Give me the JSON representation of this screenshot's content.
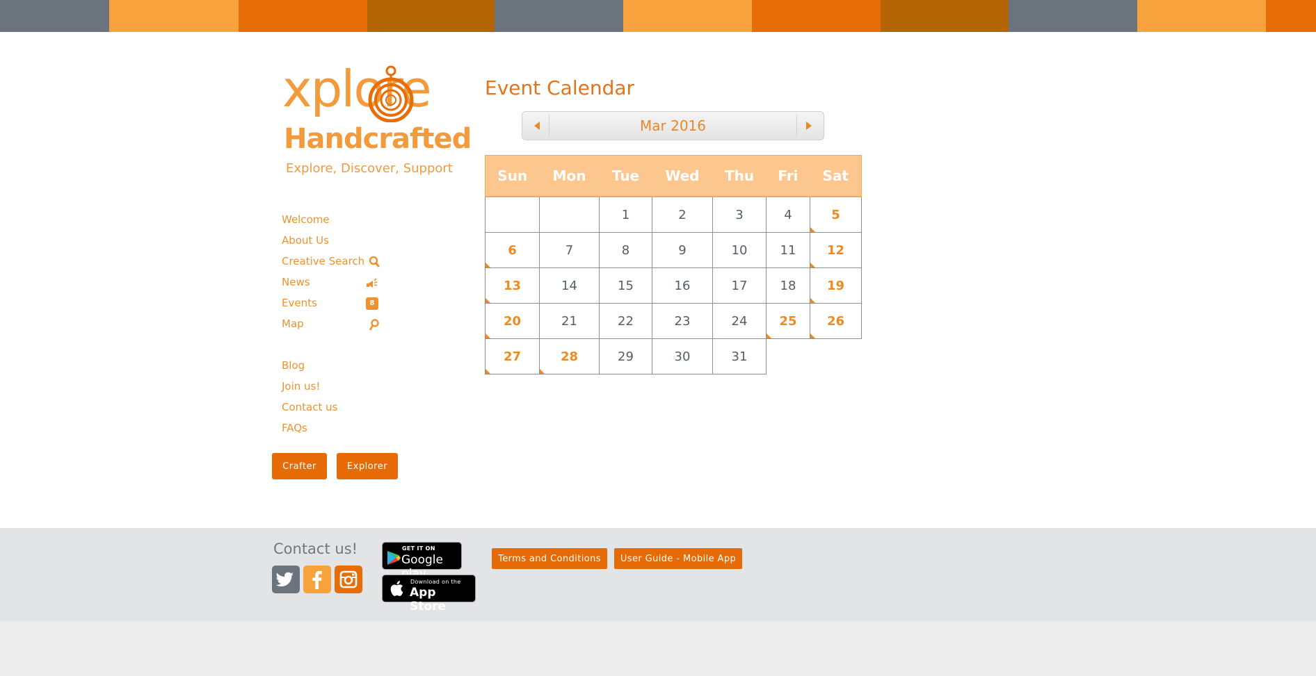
{
  "colors": {
    "accent": "#e66b06",
    "nav_text": "#f0912f",
    "title": "#e5731b",
    "header_row": "#fcc78e",
    "event_day": "#ef8a1f",
    "footer_bg": "#e3e4e6"
  },
  "topbar_colors": [
    "#6b747d",
    "#f7a23d",
    "#e66d08",
    "#b46402",
    "#6b747d",
    "#f7a23d",
    "#e66d08",
    "#b46402",
    "#6b747d",
    "#f7a23d",
    "#e66d08"
  ],
  "logo": {
    "word1": "xplore",
    "word2": "Handcrafted",
    "tagline": "Explore, Discover, Support"
  },
  "nav": {
    "items": [
      {
        "label": "Welcome",
        "icon": ""
      },
      {
        "label": "About Us",
        "icon": ""
      },
      {
        "label": "Creative Search",
        "icon": "search-icon"
      },
      {
        "label": "News",
        "icon": "megaphone-icon"
      },
      {
        "label": "Events",
        "icon": "calendar-icon"
      },
      {
        "label": "Map",
        "icon": "map-pin-icon"
      }
    ],
    "items2": [
      {
        "label": "Blog"
      },
      {
        "label": "Join us!"
      },
      {
        "label": "Contact us"
      },
      {
        "label": "FAQs"
      }
    ],
    "crafter_label": "Crafter",
    "explorer_label": "Explorer",
    "events_icon_text": "8"
  },
  "calendar": {
    "title": "Event Calendar",
    "month_label": "Mar 2016",
    "weekdays": [
      "Sun",
      "Mon",
      "Tue",
      "Wed",
      "Thu",
      "Fri",
      "Sat"
    ],
    "weeks": [
      [
        {
          "d": ""
        },
        {
          "d": ""
        },
        {
          "d": "1"
        },
        {
          "d": "2"
        },
        {
          "d": "3"
        },
        {
          "d": "4"
        },
        {
          "d": "5",
          "ev": true
        }
      ],
      [
        {
          "d": "6",
          "ev": true
        },
        {
          "d": "7"
        },
        {
          "d": "8"
        },
        {
          "d": "9"
        },
        {
          "d": "10"
        },
        {
          "d": "11"
        },
        {
          "d": "12",
          "ev": true
        }
      ],
      [
        {
          "d": "13",
          "ev": true
        },
        {
          "d": "14"
        },
        {
          "d": "15"
        },
        {
          "d": "16"
        },
        {
          "d": "17"
        },
        {
          "d": "18"
        },
        {
          "d": "19",
          "ev": true
        }
      ],
      [
        {
          "d": "20",
          "ev": true
        },
        {
          "d": "21"
        },
        {
          "d": "22"
        },
        {
          "d": "23"
        },
        {
          "d": "24"
        },
        {
          "d": "25",
          "ev": true
        },
        {
          "d": "26",
          "ev": true
        }
      ],
      [
        {
          "d": "27",
          "ev": true
        },
        {
          "d": "28",
          "ev": true
        },
        {
          "d": "29"
        },
        {
          "d": "30"
        },
        {
          "d": "31"
        },
        {
          "d": "",
          "after": true
        },
        {
          "d": "",
          "after": true
        }
      ]
    ]
  },
  "footer": {
    "contact_title": "Contact us!",
    "google_play_small": "GET IT ON",
    "google_play_big": "Google play",
    "app_store_small": "Download on the",
    "app_store_big": "App Store",
    "terms_label": "Terms and Conditions",
    "guide_label": "User Guide - Mobile App",
    "social": [
      {
        "name": "twitter",
        "color": "#6b747d"
      },
      {
        "name": "facebook",
        "color": "#f7a23d"
      },
      {
        "name": "instagram",
        "color": "#e66d08"
      }
    ]
  }
}
